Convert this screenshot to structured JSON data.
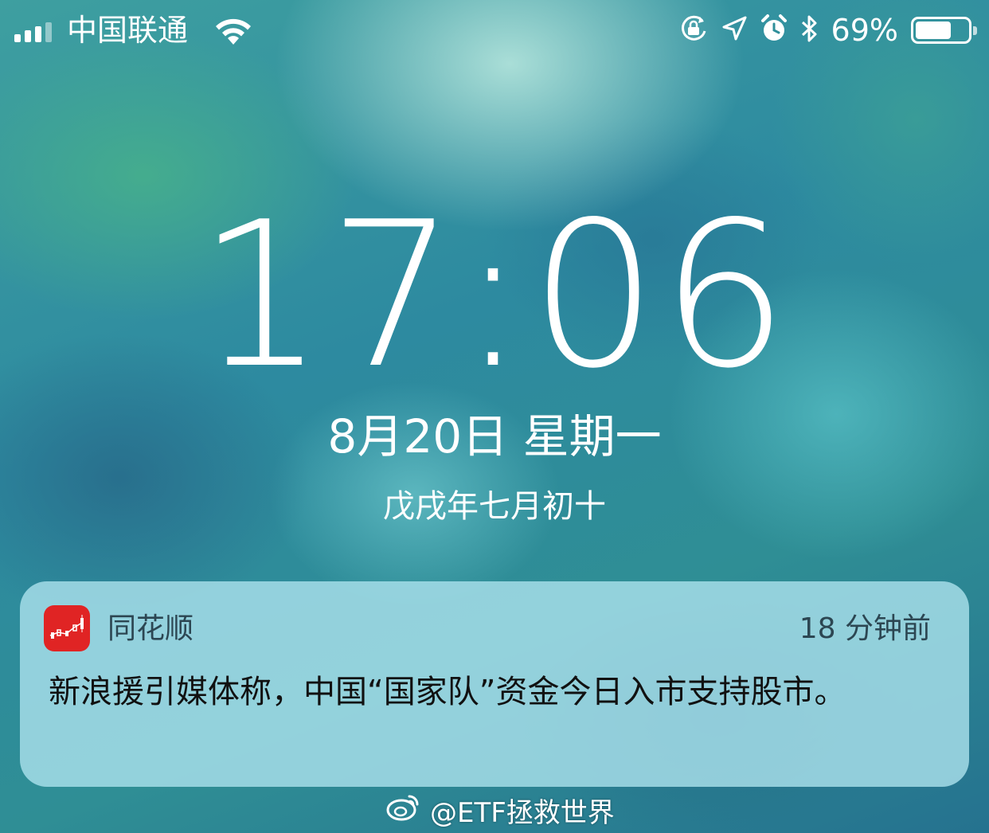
{
  "status_bar": {
    "carrier": "中国联通",
    "battery_percent": "69%",
    "battery_level": 0.69,
    "icons": [
      "signal-icon",
      "wifi-icon",
      "orientation-lock-icon",
      "location-arrow-icon",
      "alarm-icon",
      "bluetooth-icon",
      "battery-icon"
    ]
  },
  "lockscreen": {
    "time": "17:06",
    "date": "8月20日 星期一",
    "lunar_date": "戊戌年七月初十"
  },
  "notification": {
    "app_name": "同花顺",
    "time_ago": "18 分钟前",
    "body": "新浪援引媒体称，中国“国家队”资金今日入市支持股市。",
    "app_icon_color": "#e02424"
  },
  "watermark": {
    "text": "@ETF拯救世界",
    "icon": "weibo-icon"
  }
}
